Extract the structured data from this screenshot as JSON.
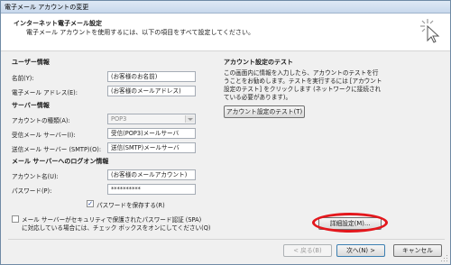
{
  "window": {
    "title": "電子メール アカウントの変更"
  },
  "header": {
    "title": "インターネット電子メール設定",
    "subtitle": "電子メール アカウントを使用するには、以下の項目をすべて設定してください。"
  },
  "user_info": {
    "section": "ユーザー情報",
    "name_label": "名前(Y):",
    "name_value": "(お客様のお名前)",
    "email_label": "電子メール アドレス(E):",
    "email_value": "(お客様のメールアドレス)"
  },
  "server_info": {
    "section": "サーバー情報",
    "account_type_label": "アカウントの種類(A):",
    "account_type_value": "POP3",
    "incoming_label": "受信メール サーバー(I):",
    "incoming_value": "受信(POP3)メールサーバ",
    "outgoing_label": "送信メール サーバー (SMTP)(O):",
    "outgoing_value": "送信(SMTP)メールサーバ"
  },
  "logon_info": {
    "section": "メール サーバーへのログオン情報",
    "account_label": "アカウント名(U):",
    "account_value": "(お客様のメールアカウント)",
    "password_label": "パスワード(P):",
    "password_value": "**********",
    "remember_password_label": "パスワードを保存する(R)",
    "remember_password_checked": true,
    "spa_label_line1": "メール サーバーがセキュリティで保護されたパスワード認証 (SPA)",
    "spa_label_line2": "に対応している場合には、チェック ボックスをオンにしてください(Q)",
    "spa_checked": false
  },
  "test": {
    "section": "アカウント設定のテスト",
    "description": "この画面内に情報を入力したら、アカウントのテストを行うことをお勧めします。テストを実行するには [アカウント設定のテスト] をクリックします (ネットワークに接続されている必要があります)。",
    "test_button": "アカウント設定のテスト(T)"
  },
  "buttons": {
    "more_settings": "詳細設定(M)...",
    "back": "< 戻る(B)",
    "next": "次へ(N) >",
    "cancel": "キャンセル"
  },
  "colors": {
    "highlight": "#e3171c",
    "titlebar": "#c7d8ec"
  }
}
